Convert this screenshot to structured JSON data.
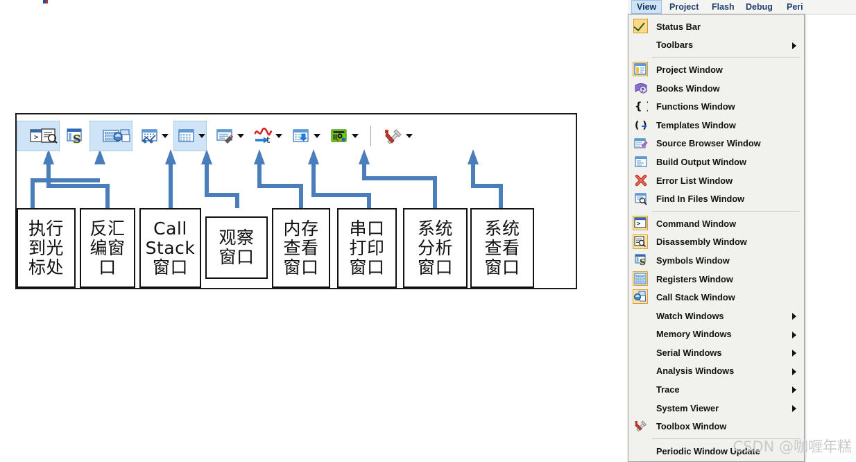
{
  "watermark": "CSDN @咖喱年糕",
  "menubar": {
    "items": [
      {
        "label": "View",
        "active": true
      },
      {
        "label": "Project",
        "active": false
      },
      {
        "label": "Flash",
        "active": false
      },
      {
        "label": "Debug",
        "active": false
      },
      {
        "label": "Peri",
        "active": false
      }
    ]
  },
  "view_menu": {
    "items": [
      {
        "label": "Status Bar",
        "icon": "checkmark-icon",
        "checked": true,
        "submenu": false,
        "separator_after": false
      },
      {
        "label": "Toolbars",
        "icon": "",
        "checked": false,
        "submenu": true,
        "separator_after": true
      },
      {
        "label": "Project Window",
        "icon": "project-window-icon",
        "checked": false,
        "submenu": false,
        "separator_after": false
      },
      {
        "label": "Books Window",
        "icon": "books-window-icon",
        "checked": false,
        "submenu": false,
        "separator_after": false
      },
      {
        "label": "Functions Window",
        "icon": "functions-window-icon",
        "checked": false,
        "submenu": false,
        "separator_after": false
      },
      {
        "label": "Templates Window",
        "icon": "templates-window-icon",
        "checked": false,
        "submenu": false,
        "separator_after": false
      },
      {
        "label": "Source Browser Window",
        "icon": "source-browser-window-icon",
        "checked": false,
        "submenu": false,
        "separator_after": false
      },
      {
        "label": "Build Output Window",
        "icon": "build-output-window-icon",
        "checked": false,
        "submenu": false,
        "separator_after": false
      },
      {
        "label": "Error List Window",
        "icon": "error-list-window-icon",
        "checked": false,
        "submenu": false,
        "separator_after": false
      },
      {
        "label": "Find In Files Window",
        "icon": "find-in-files-window-icon",
        "checked": false,
        "submenu": false,
        "separator_after": true
      },
      {
        "label": "Command Window",
        "icon": "command-window-icon",
        "checked": false,
        "submenu": false,
        "separator_after": false
      },
      {
        "label": "Disassembly Window",
        "icon": "disassembly-window-icon",
        "checked": false,
        "submenu": false,
        "separator_after": false
      },
      {
        "label": "Symbols Window",
        "icon": "symbols-window-icon",
        "checked": false,
        "submenu": false,
        "separator_after": false
      },
      {
        "label": "Registers Window",
        "icon": "registers-window-icon",
        "checked": false,
        "submenu": false,
        "separator_after": false
      },
      {
        "label": "Call Stack Window",
        "icon": "call-stack-window-icon",
        "checked": false,
        "submenu": false,
        "separator_after": false
      },
      {
        "label": "Watch Windows",
        "icon": "",
        "checked": false,
        "submenu": true,
        "separator_after": false
      },
      {
        "label": "Memory Windows",
        "icon": "",
        "checked": false,
        "submenu": true,
        "separator_after": false
      },
      {
        "label": "Serial Windows",
        "icon": "",
        "checked": false,
        "submenu": true,
        "separator_after": false
      },
      {
        "label": "Analysis Windows",
        "icon": "",
        "checked": false,
        "submenu": true,
        "separator_after": false
      },
      {
        "label": "Trace",
        "icon": "",
        "checked": false,
        "submenu": true,
        "separator_after": false
      },
      {
        "label": "System Viewer",
        "icon": "",
        "checked": false,
        "submenu": true,
        "separator_after": false
      },
      {
        "label": "Toolbox Window",
        "icon": "toolbox-window-icon",
        "checked": false,
        "submenu": false,
        "separator_after": true
      },
      {
        "label": "Periodic Window Update",
        "icon": "",
        "checked": false,
        "submenu": false,
        "separator_after": false
      }
    ]
  },
  "toolbar": {
    "buttons": [
      {
        "name": "command-window-button",
        "icon": "command-window-icon",
        "highlighted": true,
        "caret": false
      },
      {
        "name": "disassembly-window-button",
        "icon": "disassembly-window-icon",
        "highlighted": true,
        "caret": false
      },
      {
        "name": "symbols-window-button",
        "icon": "symbols-window-icon",
        "highlighted": false,
        "caret": false
      },
      {
        "name": "registers-window-button",
        "icon": "registers-window-icon",
        "highlighted": true,
        "caret": false
      },
      {
        "name": "call-stack-window-button",
        "icon": "call-stack-window-icon",
        "highlighted": true,
        "caret": false
      },
      {
        "name": "watch-windows-button",
        "icon": "watch-window-icon",
        "highlighted": false,
        "caret": true
      },
      {
        "name": "memory-windows-button",
        "icon": "memory-window-icon",
        "highlighted": true,
        "caret": true
      },
      {
        "name": "serial-windows-button",
        "icon": "serial-window-icon",
        "highlighted": false,
        "caret": true
      },
      {
        "name": "analysis-windows-button",
        "icon": "analysis-window-icon",
        "highlighted": false,
        "caret": true
      },
      {
        "name": "trace-button",
        "icon": "trace-icon",
        "highlighted": false,
        "caret": true
      },
      {
        "name": "system-viewer-button",
        "icon": "system-viewer-icon",
        "highlighted": false,
        "caret": true
      },
      {
        "name": "toolbox-window-button",
        "icon": "toolbox-window-icon",
        "highlighted": false,
        "caret": true
      }
    ]
  },
  "callouts": [
    {
      "name": "callout-run-to-cursor",
      "lines": [
        "执行",
        "到光",
        "标处"
      ]
    },
    {
      "name": "callout-disassembly",
      "lines": [
        "反汇",
        "编窗",
        "口"
      ]
    },
    {
      "name": "callout-call-stack",
      "lines": [
        "Call",
        "Stack",
        "窗口"
      ]
    },
    {
      "name": "callout-watch",
      "lines": [
        "观察",
        "窗口"
      ]
    },
    {
      "name": "callout-memory",
      "lines": [
        "内存",
        "查看",
        "窗口"
      ]
    },
    {
      "name": "callout-serial",
      "lines": [
        "串口",
        "打印",
        "窗口"
      ]
    },
    {
      "name": "callout-analysis",
      "lines": [
        "系统",
        "分析",
        "窗口"
      ]
    },
    {
      "name": "callout-system-viewer",
      "lines": [
        "系统",
        "查看",
        "窗口"
      ]
    }
  ],
  "colors": {
    "accent_blue": "#4a7ebb",
    "highlight_blue": "#cfe4f7",
    "menu_bg": "#f1f1ee",
    "check_gold": "#ffd98a",
    "outline": "#111111"
  }
}
